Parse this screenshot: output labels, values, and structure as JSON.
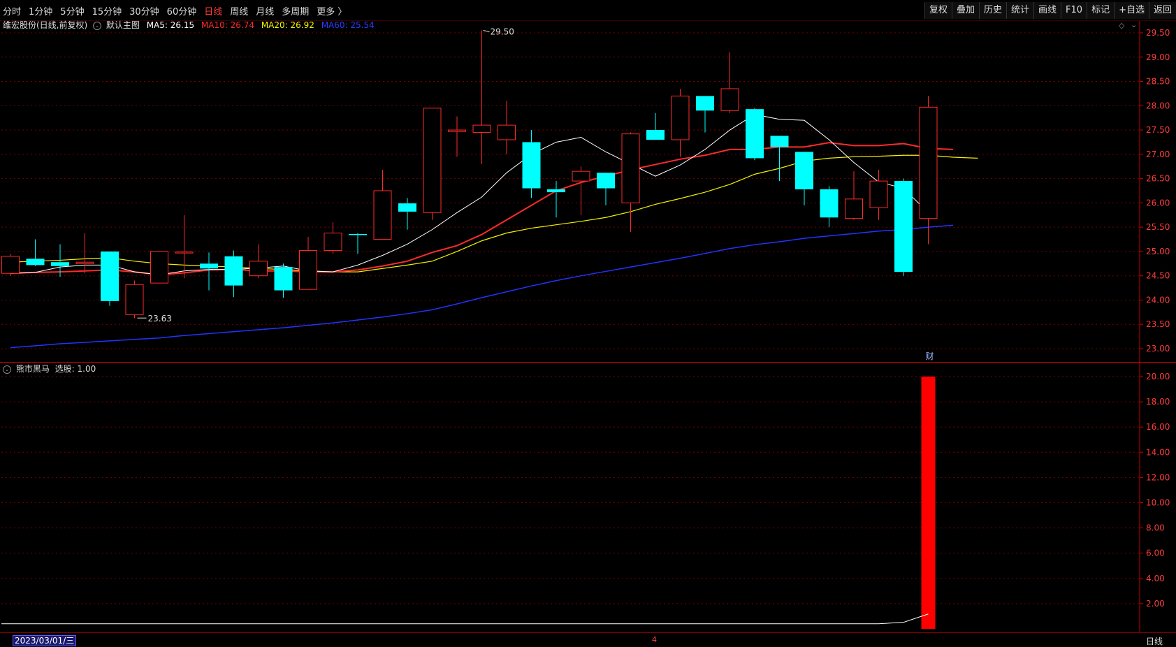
{
  "toolbar": {
    "periods": [
      "分时",
      "1分钟",
      "5分钟",
      "15分钟",
      "30分钟",
      "60分钟",
      "日线",
      "周线",
      "月线",
      "多周期",
      "更多 〉"
    ],
    "active_period": "日线",
    "actions": [
      "复权",
      "叠加",
      "历史",
      "统计",
      "画线",
      "F10",
      "标记",
      "+自选",
      "返回"
    ]
  },
  "main_chart": {
    "title": "维宏股份(日线,前复权)",
    "main_label": "默认主图",
    "ma5": {
      "label": "MA5: 26.15",
      "color": "#ffffff"
    },
    "ma10": {
      "label": "MA10: 26.74",
      "color": "#ff2a2a"
    },
    "ma20": {
      "label": "MA20: 26.92",
      "color": "#f2f200"
    },
    "ma60": {
      "label": "MA60: 25.54",
      "color": "#2233ff"
    },
    "high_marker": "29.50",
    "low_marker": "23.63",
    "finance_mark": "财"
  },
  "indicator": {
    "title": "熊市黑马",
    "value_label": "选股: 1.00"
  },
  "statusbar": {
    "date": "2023/03/01/三",
    "month_mark": "4",
    "period": "日线"
  },
  "colors": {
    "up": "#ff2a2a",
    "down": "#00ffff",
    "grid": "#7a0000",
    "axis": "#cc0000"
  },
  "chart_data": [
    {
      "type": "candlestick",
      "ylim": [
        22.8,
        29.75
      ],
      "y_ticks": [
        23.0,
        23.5,
        24.0,
        24.5,
        25.0,
        25.5,
        26.0,
        26.5,
        27.0,
        27.5,
        28.0,
        28.5,
        29.0,
        29.5
      ],
      "candles": [
        {
          "o": 24.55,
          "h": 24.95,
          "l": 24.5,
          "c": 24.9
        },
        {
          "o": 24.85,
          "h": 25.25,
          "l": 24.7,
          "c": 24.72
        },
        {
          "o": 24.78,
          "h": 25.15,
          "l": 24.48,
          "c": 24.7
        },
        {
          "o": 24.75,
          "h": 25.38,
          "l": 24.55,
          "c": 24.78
        },
        {
          "o": 25.0,
          "h": 25.0,
          "l": 23.88,
          "c": 23.98
        },
        {
          "o": 23.7,
          "h": 24.4,
          "l": 23.63,
          "c": 24.32
        },
        {
          "o": 24.35,
          "h": 25.0,
          "l": 24.35,
          "c": 25.0
        },
        {
          "o": 24.97,
          "h": 25.75,
          "l": 24.45,
          "c": 24.99
        },
        {
          "o": 24.75,
          "h": 24.98,
          "l": 24.2,
          "c": 24.65
        },
        {
          "o": 24.9,
          "h": 25.02,
          "l": 24.06,
          "c": 24.3
        },
        {
          "o": 24.5,
          "h": 25.15,
          "l": 24.45,
          "c": 24.8
        },
        {
          "o": 24.68,
          "h": 24.75,
          "l": 24.05,
          "c": 24.2
        },
        {
          "o": 24.22,
          "h": 25.3,
          "l": 24.22,
          "c": 25.02
        },
        {
          "o": 25.02,
          "h": 25.6,
          "l": 24.95,
          "c": 25.38
        },
        {
          "o": 25.36,
          "h": 25.38,
          "l": 24.95,
          "c": 25.34
        },
        {
          "o": 25.25,
          "h": 26.68,
          "l": 25.25,
          "c": 26.25
        },
        {
          "o": 25.99,
          "h": 26.1,
          "l": 25.45,
          "c": 25.82
        },
        {
          "o": 25.8,
          "h": 27.95,
          "l": 25.65,
          "c": 27.95
        },
        {
          "o": 27.47,
          "h": 27.78,
          "l": 26.95,
          "c": 27.5
        },
        {
          "o": 27.45,
          "h": 29.55,
          "l": 26.8,
          "c": 27.6
        },
        {
          "o": 27.3,
          "h": 28.1,
          "l": 27.0,
          "c": 27.6
        },
        {
          "o": 27.25,
          "h": 27.5,
          "l": 26.1,
          "c": 26.3
        },
        {
          "o": 26.28,
          "h": 26.45,
          "l": 25.7,
          "c": 26.22
        },
        {
          "o": 26.45,
          "h": 26.75,
          "l": 25.75,
          "c": 26.65
        },
        {
          "o": 26.62,
          "h": 26.62,
          "l": 25.95,
          "c": 26.3
        },
        {
          "o": 26.0,
          "h": 27.45,
          "l": 25.4,
          "c": 27.42
        },
        {
          "o": 27.5,
          "h": 27.85,
          "l": 27.3,
          "c": 27.3
        },
        {
          "o": 27.3,
          "h": 28.35,
          "l": 26.95,
          "c": 28.2
        },
        {
          "o": 28.2,
          "h": 28.2,
          "l": 27.45,
          "c": 27.9
        },
        {
          "o": 27.9,
          "h": 29.1,
          "l": 27.85,
          "c": 28.35
        },
        {
          "o": 27.93,
          "h": 27.95,
          "l": 26.88,
          "c": 26.92
        },
        {
          "o": 27.38,
          "h": 27.38,
          "l": 26.45,
          "c": 27.15
        },
        {
          "o": 27.05,
          "h": 27.05,
          "l": 25.95,
          "c": 26.28
        },
        {
          "o": 26.28,
          "h": 26.35,
          "l": 25.5,
          "c": 25.7
        },
        {
          "o": 25.68,
          "h": 26.65,
          "l": 25.65,
          "c": 26.08
        },
        {
          "o": 25.9,
          "h": 26.68,
          "l": 25.65,
          "c": 26.45
        },
        {
          "o": 26.45,
          "h": 26.5,
          "l": 24.5,
          "c": 24.58
        },
        {
          "o": 25.68,
          "h": 28.2,
          "l": 25.15,
          "c": 27.97
        }
      ],
      "ma5": [
        24.55,
        24.57,
        24.68,
        24.72,
        24.72,
        24.58,
        24.52,
        24.6,
        24.63,
        24.63,
        24.66,
        24.7,
        24.6,
        24.58,
        24.72,
        24.92,
        25.15,
        25.45,
        25.8,
        26.12,
        26.62,
        27.0,
        27.25,
        27.35,
        27.05,
        26.8,
        26.55,
        26.78,
        27.1,
        27.5,
        27.82,
        27.72,
        27.7,
        27.3,
        26.83,
        26.43,
        26.3,
        25.8,
        26.13
      ],
      "ma10": [
        24.55,
        24.57,
        24.58,
        24.6,
        24.62,
        24.58,
        24.52,
        24.56,
        24.62,
        24.63,
        24.6,
        24.6,
        24.58,
        24.58,
        24.62,
        24.7,
        24.8,
        24.98,
        25.12,
        25.35,
        25.65,
        25.95,
        26.25,
        26.42,
        26.55,
        26.68,
        26.79,
        26.9,
        26.98,
        27.1,
        27.1,
        27.15,
        27.15,
        27.24,
        27.18,
        27.18,
        27.22,
        27.12,
        27.1,
        26.97,
        26.74,
        26.74
      ],
      "ma20": [
        24.78,
        24.8,
        24.82,
        24.85,
        24.87,
        24.8,
        24.75,
        24.72,
        24.7,
        24.68,
        24.65,
        24.63,
        24.6,
        24.58,
        24.58,
        24.65,
        24.72,
        24.8,
        25.0,
        25.22,
        25.38,
        25.48,
        25.55,
        25.62,
        25.7,
        25.82,
        25.97,
        26.09,
        26.22,
        26.38,
        26.59,
        26.71,
        26.86,
        26.92,
        26.95,
        26.96,
        26.98,
        26.98,
        26.94,
        26.92
      ],
      "ma60": [
        23.02,
        23.06,
        23.1,
        23.13,
        23.16,
        23.19,
        23.22,
        23.27,
        23.31,
        23.35,
        23.39,
        23.43,
        23.48,
        23.53,
        23.59,
        23.65,
        23.72,
        23.8,
        23.92,
        24.05,
        24.17,
        24.29,
        24.4,
        24.5,
        24.59,
        24.68,
        24.77,
        24.86,
        24.96,
        25.06,
        25.14,
        25.2,
        25.27,
        25.32,
        25.37,
        25.42,
        25.45,
        25.5,
        25.54
      ]
    },
    {
      "type": "bar",
      "title": "熊市黑马",
      "ylim": [
        0,
        20.6
      ],
      "y_ticks": [
        2.0,
        4.0,
        6.0,
        8.0,
        10.0,
        12.0,
        14.0,
        16.0,
        18.0,
        20.0
      ],
      "values": [
        0,
        0,
        0,
        0,
        0,
        0,
        0,
        0,
        0,
        0,
        0,
        0,
        0,
        0,
        0,
        0,
        0,
        0,
        0,
        0,
        0,
        0,
        0,
        0,
        0,
        0,
        0,
        0,
        0,
        0,
        0,
        0,
        0,
        0,
        0,
        0,
        0,
        20
      ],
      "line": [
        0,
        0,
        0,
        0,
        0,
        0,
        0,
        0,
        0,
        0,
        0,
        0,
        0,
        0,
        0,
        0,
        0,
        0,
        0,
        0,
        0,
        0,
        0,
        0,
        0,
        0,
        0,
        0,
        0,
        0,
        0,
        0,
        0,
        0,
        0,
        0,
        0.15,
        1.0
      ]
    }
  ]
}
